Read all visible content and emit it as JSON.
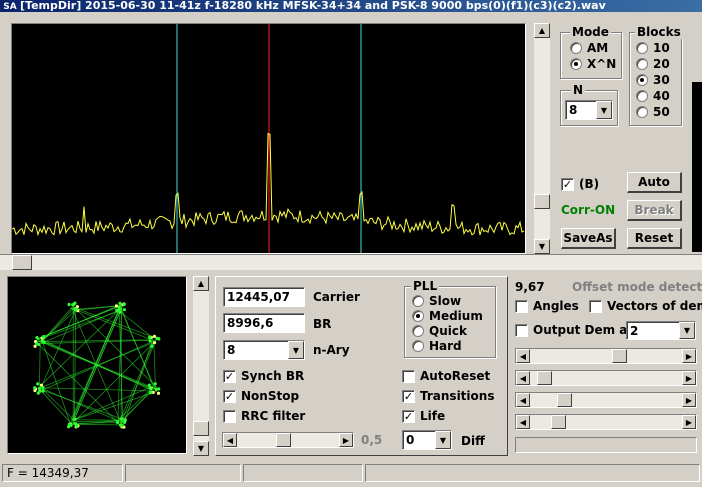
{
  "window": {
    "app_icon_text": "SA",
    "title": "[TempDir] 2015-06-30 11-41z f-18280 kHz MFSK-34+34 and PSK-8 9000 bps(0)(f1)(c3)(c2).wav"
  },
  "spectrum": {
    "background": "#000000",
    "trace_color": "#ffff40",
    "markers": [
      {
        "name": "left",
        "color": "#40e0e0"
      },
      {
        "name": "center",
        "color": "#ff2020"
      },
      {
        "name": "right",
        "color": "#40e0e0"
      }
    ]
  },
  "mode_group": {
    "title": "Mode",
    "options": [
      {
        "label": "AM",
        "selected": false
      },
      {
        "label": "X^N",
        "selected": true
      }
    ]
  },
  "blocks_group": {
    "title": "Blocks",
    "options": [
      {
        "label": "10",
        "selected": false
      },
      {
        "label": "20",
        "selected": false
      },
      {
        "label": "30",
        "selected": true
      },
      {
        "label": "40",
        "selected": false
      },
      {
        "label": "50",
        "selected": false
      }
    ]
  },
  "n_group": {
    "title": "N",
    "value": "8"
  },
  "b_checkbox": {
    "label": "(B)",
    "checked": true
  },
  "corr_status": {
    "text": "Corr-ON",
    "color": "#008000"
  },
  "buttons": {
    "auto": "Auto",
    "break": "Break",
    "saveas": "SaveAs",
    "reset": "Reset"
  },
  "constellation": {
    "background": "#000000",
    "color": "#30ff30"
  },
  "params": {
    "carrier_value": "12445,07",
    "carrier_label": "Carrier",
    "br_value": "8996,6",
    "br_label": "BR",
    "nary_value": "8",
    "nary_label": "n-Ary",
    "synch_br": {
      "label": "Synch BR",
      "checked": true
    },
    "nonstop": {
      "label": "NonStop",
      "checked": true
    },
    "rrc_filter": {
      "label": "RRC filter",
      "checked": false
    },
    "rrc_value": "0,5",
    "rrc_slider_level": 0.45
  },
  "pll_group": {
    "title": "PLL",
    "options": [
      {
        "label": "Slow",
        "selected": false
      },
      {
        "label": "Medium",
        "selected": true
      },
      {
        "label": "Quick",
        "selected": false
      },
      {
        "label": "Hard",
        "selected": false
      }
    ]
  },
  "right_checks": {
    "autoreset": {
      "label": "AutoReset",
      "checked": false
    },
    "transitions": {
      "label": "Transitions",
      "checked": true
    },
    "life": {
      "label": "Life",
      "checked": true
    }
  },
  "diff": {
    "value": "0",
    "label": "Diff"
  },
  "offset_panel": {
    "value": "9,67",
    "status": "Offset mode detected",
    "angles": {
      "label": "Angles",
      "checked": false
    },
    "vectors": {
      "label": "Vectors of dem",
      "checked": false
    },
    "output_dem": {
      "label": "Output Dem as",
      "checked": false
    },
    "output_value": "2",
    "slider_levels": [
      0.6,
      0.05,
      0.2,
      0.15
    ]
  },
  "statusbar": {
    "freq": "F = 14349,37",
    "panel2": "",
    "panel3": "",
    "panel4": ""
  },
  "check_mark": "✓",
  "arrows": {
    "up": "▲",
    "down": "▼",
    "left": "◀",
    "right": "▶"
  }
}
